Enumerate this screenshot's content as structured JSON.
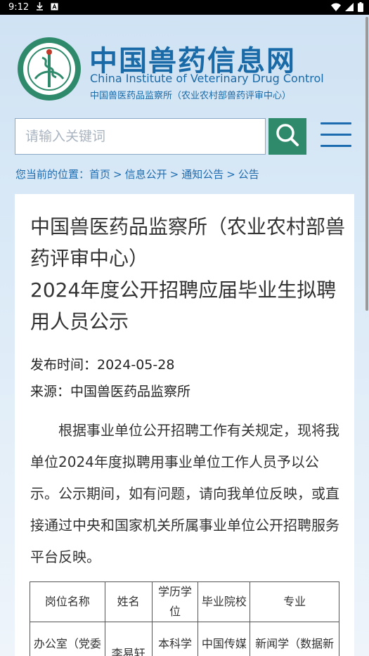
{
  "status_bar": {
    "time": "9:12"
  },
  "header": {
    "brand_cn": "中国兽药信息网",
    "brand_en": "China Institute of Veterinary Drug Control",
    "brand_sub": "中国兽医药品监察所（农业农村部兽药评审中心）"
  },
  "search": {
    "placeholder": "请输入关键词"
  },
  "breadcrumb": {
    "prefix": "您当前的位置：",
    "items": [
      "首页",
      "信息公开",
      "通知公告",
      "公告"
    ],
    "separator": ">"
  },
  "article": {
    "title_line1": "中国兽医药品监察所（农业农村部兽药评审中心）",
    "title_line2": "2024年度公开招聘应届毕业生拟聘用人员公示",
    "publish_time": "发布时间：2024-05-28",
    "source": "来源：中国兽医药品监察所",
    "body": "根据事业单位公开招聘工作有关规定，现将我单位2024年度拟聘用事业单位工作人员予以公示。公示期间，如有问题，请向我单位反映，或直接通过中央和国家机关所属事业单位公开招聘服务平台反映。"
  },
  "table": {
    "headers": [
      "岗位名称",
      "姓名",
      "学历学位",
      "毕业院校",
      "专业"
    ],
    "rows": [
      [
        "办公室（党委办公室）",
        "李易轩",
        "本科学士",
        "中国传媒大学",
        "新闻学（数据新闻报道方向）"
      ]
    ]
  },
  "colors": {
    "brand_blue": "#1a6aa8",
    "search_green": "#2f8a6b",
    "link_blue": "#1e6cb0"
  }
}
